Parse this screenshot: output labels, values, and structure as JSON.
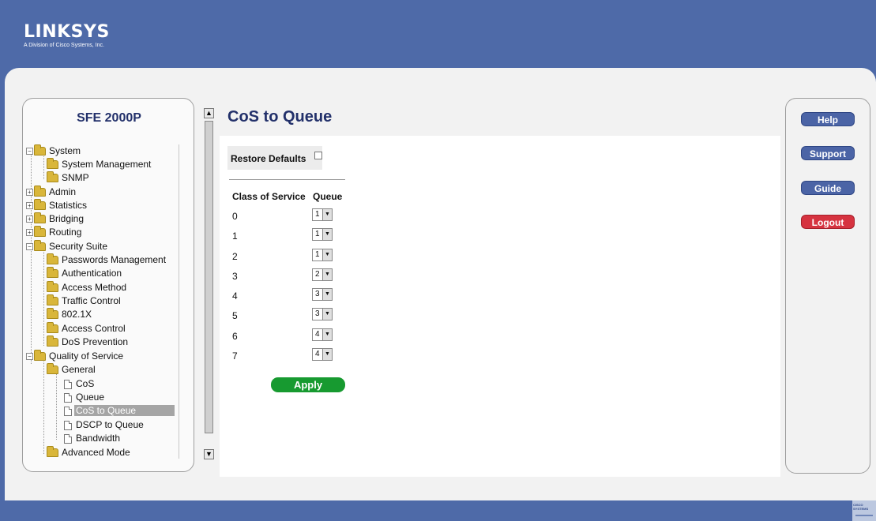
{
  "brand": {
    "name": "LINKSYS",
    "tagline": "A Division of Cisco Systems, Inc."
  },
  "footer": {
    "badge": "CISCO SYSTEMS"
  },
  "device": {
    "model": "SFE 2000P"
  },
  "nav": {
    "system": "System",
    "system_management": "System Management",
    "snmp": "SNMP",
    "admin": "Admin",
    "statistics": "Statistics",
    "bridging": "Bridging",
    "routing": "Routing",
    "security_suite": "Security Suite",
    "passwords_management": "Passwords Management",
    "authentication": "Authentication",
    "access_method": "Access Method",
    "traffic_control": "Traffic Control",
    "dot1x": "802.1X",
    "access_control": "Access Control",
    "dos_prevention": "DoS Prevention",
    "qos": "Quality of Service",
    "general": "General",
    "cos": "CoS",
    "queue": "Queue",
    "cos_to_queue": "CoS to Queue",
    "dscp_to_queue": "DSCP to Queue",
    "bandwidth": "Bandwidth",
    "advanced_mode": "Advanced Mode"
  },
  "page": {
    "title": "CoS to Queue",
    "restore_defaults": "Restore Defaults",
    "col_cos": "Class of Service",
    "col_queue": "Queue",
    "rows": [
      {
        "cos": "0",
        "queue": "1"
      },
      {
        "cos": "1",
        "queue": "1"
      },
      {
        "cos": "2",
        "queue": "1"
      },
      {
        "cos": "3",
        "queue": "2"
      },
      {
        "cos": "4",
        "queue": "3"
      },
      {
        "cos": "5",
        "queue": "3"
      },
      {
        "cos": "6",
        "queue": "4"
      },
      {
        "cos": "7",
        "queue": "4"
      }
    ],
    "apply": "Apply"
  },
  "side": {
    "help": "Help",
    "support": "Support",
    "guide": "Guide",
    "logout": "Logout"
  },
  "colors": {
    "header": "#4e6aa8",
    "apply": "#179a30",
    "logout": "#d63340",
    "side_button": "#4b64a6"
  }
}
